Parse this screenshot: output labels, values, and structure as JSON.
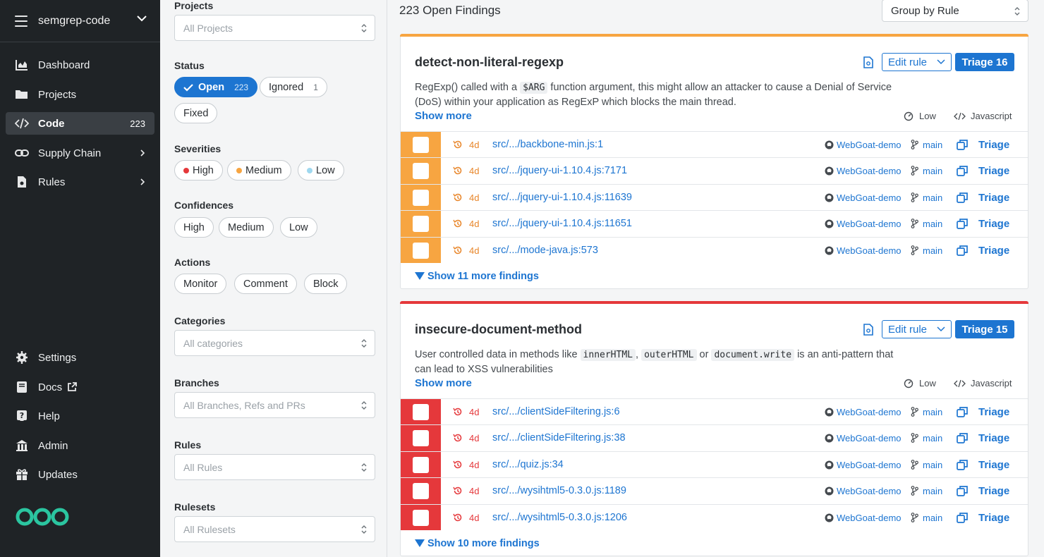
{
  "sidebar": {
    "org": "semgrep-code",
    "nav": [
      {
        "label": "Dashboard"
      },
      {
        "label": "Projects"
      },
      {
        "label": "Code",
        "count": "223"
      },
      {
        "label": "Supply Chain"
      },
      {
        "label": "Rules"
      }
    ],
    "bottom": [
      {
        "label": "Settings"
      },
      {
        "label": "Docs"
      },
      {
        "label": "Help"
      },
      {
        "label": "Admin"
      },
      {
        "label": "Updates"
      }
    ]
  },
  "filters": {
    "projects": {
      "label": "Projects",
      "placeholder": "All Projects"
    },
    "status": {
      "label": "Status",
      "open": "Open",
      "open_count": "223",
      "ignored": "Ignored",
      "ignored_count": "1",
      "fixed": "Fixed"
    },
    "severities": {
      "label": "Severities",
      "high": "High",
      "medium": "Medium",
      "low": "Low"
    },
    "confidences": {
      "label": "Confidences",
      "high": "High",
      "medium": "Medium",
      "low": "Low"
    },
    "actions": {
      "label": "Actions",
      "monitor": "Monitor",
      "comment": "Comment",
      "block": "Block"
    },
    "categories": {
      "label": "Categories",
      "placeholder": "All categories"
    },
    "branches": {
      "label": "Branches",
      "placeholder": "All Branches, Refs and PRs"
    },
    "rules": {
      "label": "Rules",
      "placeholder": "All Rules"
    },
    "rulesets": {
      "label": "Rulesets",
      "placeholder": "All Rulesets"
    }
  },
  "main": {
    "open_findings": "223 Open Findings",
    "group_by": "Group by Rule",
    "cards": [
      {
        "title": "detect-non-literal-regexp",
        "edit_rule": "Edit rule",
        "triage": "Triage 16",
        "desc_1": "RegExp() called with a ",
        "code_1": "$ARG",
        "desc_2": " function argument, this might allow an attacker to cause a Denial of Service (DoS) within your application as RegExP which blocks the main thread.",
        "show_more": "Show more",
        "confidence": "Low",
        "language": "Javascript",
        "more_findings": "Show 11 more findings",
        "rows": [
          {
            "age": "4d",
            "path": "src/.../backbone-min.js:1",
            "repo": "WebGoat-demo",
            "branch": "main",
            "triage": "Triage"
          },
          {
            "age": "4d",
            "path": "src/.../jquery-ui-1.10.4.js:7171",
            "repo": "WebGoat-demo",
            "branch": "main",
            "triage": "Triage"
          },
          {
            "age": "4d",
            "path": "src/.../jquery-ui-1.10.4.js:11639",
            "repo": "WebGoat-demo",
            "branch": "main",
            "triage": "Triage"
          },
          {
            "age": "4d",
            "path": "src/.../jquery-ui-1.10.4.js:11651",
            "repo": "WebGoat-demo",
            "branch": "main",
            "triage": "Triage"
          },
          {
            "age": "4d",
            "path": "src/.../mode-java.js:573",
            "repo": "WebGoat-demo",
            "branch": "main",
            "triage": "Triage"
          }
        ]
      },
      {
        "title": "insecure-document-method",
        "edit_rule": "Edit rule",
        "triage": "Triage 15",
        "desc_1": "User controlled data in methods like ",
        "code_1": "innerHTML",
        "desc_2": ", ",
        "code_2": "outerHTML",
        "desc_3": " or ",
        "code_3": "document.write",
        "desc_4": " is an anti-pattern that can lead to XSS vulnerabilities",
        "show_more": "Show more",
        "confidence": "Low",
        "language": "Javascript",
        "more_findings": "Show 10 more findings",
        "rows": [
          {
            "age": "4d",
            "path": "src/.../clientSideFiltering.js:6",
            "repo": "WebGoat-demo",
            "branch": "main",
            "triage": "Triage"
          },
          {
            "age": "4d",
            "path": "src/.../clientSideFiltering.js:38",
            "repo": "WebGoat-demo",
            "branch": "main",
            "triage": "Triage"
          },
          {
            "age": "4d",
            "path": "src/.../quiz.js:34",
            "repo": "WebGoat-demo",
            "branch": "main",
            "triage": "Triage"
          },
          {
            "age": "4d",
            "path": "src/.../wysihtml5-0.3.0.js:1189",
            "repo": "WebGoat-demo",
            "branch": "main",
            "triage": "Triage"
          },
          {
            "age": "4d",
            "path": "src/.../wysihtml5-0.3.0.js:1206",
            "repo": "WebGoat-demo",
            "branch": "main",
            "triage": "Triage"
          }
        ]
      }
    ]
  },
  "colors": {
    "accent": "#1d75d1",
    "medium": "#f7a541",
    "high": "#e5383b",
    "sidebar": "#1f2326"
  }
}
